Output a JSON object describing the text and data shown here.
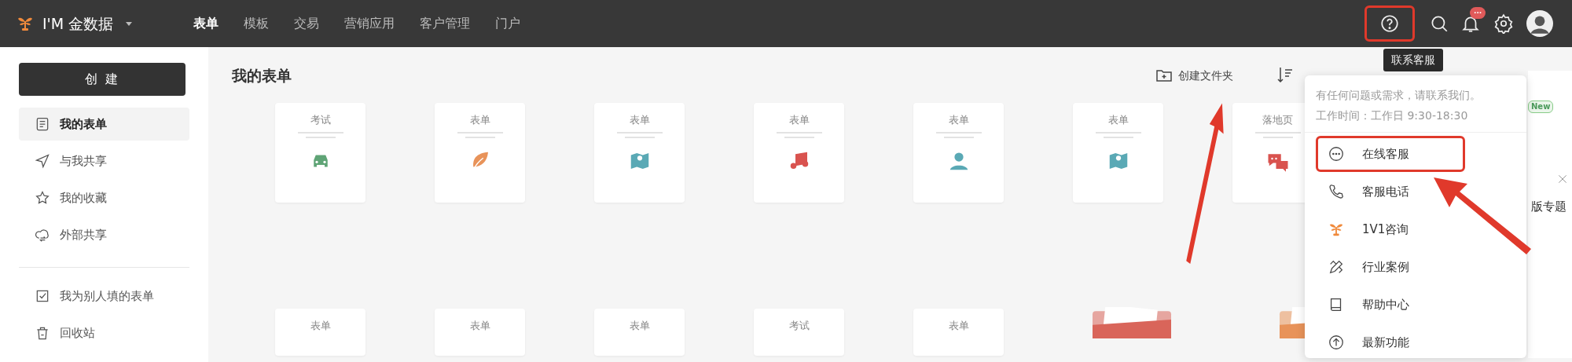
{
  "topbar": {
    "brand": "I'M 金数据",
    "nav": [
      {
        "label": "表单",
        "selected": true
      },
      {
        "label": "模板",
        "selected": false
      },
      {
        "label": "交易",
        "selected": false
      },
      {
        "label": "营销应用",
        "selected": false
      },
      {
        "label": "客户管理",
        "selected": false
      },
      {
        "label": "门户",
        "selected": false
      }
    ],
    "notification_badge": "···",
    "tooltip": "联系客服"
  },
  "sidebar": {
    "create_button": "创 建",
    "groups": [
      [
        {
          "label": "我的表单",
          "selected": true
        },
        {
          "label": "与我共享",
          "selected": false
        },
        {
          "label": "我的收藏",
          "selected": false
        },
        {
          "label": "外部共享",
          "selected": false
        }
      ],
      [
        {
          "label": "我为别人填的表单",
          "selected": false
        },
        {
          "label": "回收站",
          "selected": false
        }
      ]
    ]
  },
  "main": {
    "title": "我的表单",
    "create_folder": "创建文件夹",
    "cards": [
      {
        "label": "考试",
        "color": "#5fa476"
      },
      {
        "label": "表单",
        "color": "#e8935a"
      },
      {
        "label": "表单",
        "color": "#5aa9b5"
      },
      {
        "label": "表单",
        "color": "#d9534f"
      },
      {
        "label": "表单",
        "color": "#5aa9b5"
      },
      {
        "label": "表单",
        "color": "#5aa9b5"
      },
      {
        "label": "落地页",
        "color": "#d9534f"
      }
    ],
    "second_row": [
      {
        "kind": "card",
        "label": "表单"
      },
      {
        "kind": "card",
        "label": "表单"
      },
      {
        "kind": "card",
        "label": "表单"
      },
      {
        "kind": "card",
        "label": "考试"
      },
      {
        "kind": "card",
        "label": "表单"
      },
      {
        "kind": "folder",
        "color": "#d9655a"
      },
      {
        "kind": "folder",
        "color": "#e8935a"
      }
    ]
  },
  "help_menu": {
    "intro": "有任何问题或需求，请联系我们。",
    "hours": "工作时间：工作日 9:30-18:30",
    "items": [
      {
        "label": "在线客服",
        "highlighted": true
      },
      {
        "label": "客服电话",
        "highlighted": false
      },
      {
        "label": "1V1咨询",
        "highlighted": false
      },
      {
        "label": "行业案例",
        "highlighted": false
      },
      {
        "label": "帮助中心",
        "highlighted": false
      },
      {
        "label": "最新功能",
        "highlighted": false
      }
    ]
  },
  "side_panel": {
    "badge": "New",
    "text": "版专题"
  }
}
